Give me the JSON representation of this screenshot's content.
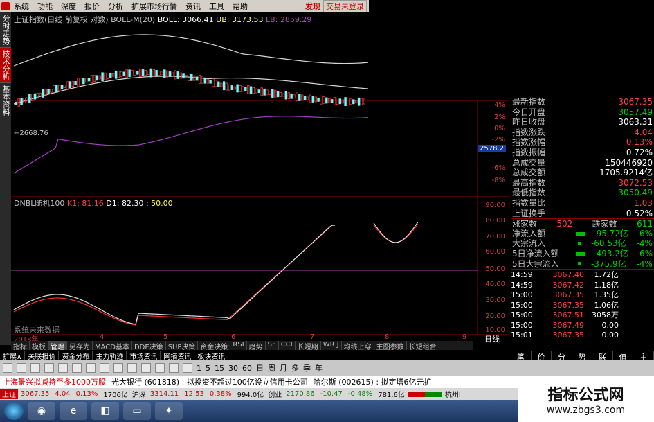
{
  "menu": [
    "系统",
    "功能",
    "深度",
    "报价",
    "分析",
    "扩展市场行情",
    "资讯",
    "工具",
    "帮助"
  ],
  "top_right": {
    "discover": "发现",
    "trade": "交易未登录"
  },
  "left_tabs": [
    "分时走势",
    "技术分析",
    "基本资料"
  ],
  "legend": {
    "title": "上证指数(日线 前复权 对数)",
    "boll": "BOLL-M(20)",
    "boll_val": "BOLL: 3066.41",
    "ub": "UB: 3173.53",
    "lb": "LB: 2859.29",
    "low_label": "←2668.76"
  },
  "indicator": {
    "name": "DNBL随机100",
    "k1": "K1: 81.16",
    "d1": "D1: 82.30",
    "v": ": 50.00",
    "watermark": "系统未来数据"
  },
  "axis_pct": [
    "4%",
    "2%",
    "0%",
    "-2%",
    "-4%",
    "-6%",
    "-8%"
  ],
  "axis_ind": [
    "90.00",
    "80.00",
    "70.00",
    "60.00",
    "50.00",
    "40.00",
    "30.00",
    "20.00",
    "10.00"
  ],
  "blue_tag": "2578.2",
  "x_labels": [
    "2018年",
    "4",
    "5",
    "6",
    "7",
    "8",
    "9"
  ],
  "day_label": "日线",
  "stats": [
    {
      "l": "最新指数",
      "v": "3067.35",
      "c": "red"
    },
    {
      "l": "今日开盘",
      "v": "3057.49",
      "c": "green"
    },
    {
      "l": "昨日收盘",
      "v": "3063.31",
      "c": "white"
    },
    {
      "l": "指数涨跌",
      "v": "4.04",
      "c": "red"
    },
    {
      "l": "指数涨幅",
      "v": "0.13%",
      "c": "red"
    },
    {
      "l": "指数振幅",
      "v": "0.72%",
      "c": "white"
    },
    {
      "l": "总成交量",
      "v": "150446920",
      "c": "white"
    },
    {
      "l": "总成交额",
      "v": "1705.9214亿",
      "c": "white"
    },
    {
      "l": "最高指数",
      "v": "3072.53",
      "c": "red"
    },
    {
      "l": "最低指数",
      "v": "3050.49",
      "c": "green"
    },
    {
      "l": "指数量比",
      "v": "1.03",
      "c": "red"
    },
    {
      "l": "上证换手",
      "v": "0.52%",
      "c": "white"
    }
  ],
  "updown": {
    "up_label": "涨家数",
    "up": "502",
    "down_label": "跌家数",
    "down": "611"
  },
  "flows": [
    {
      "l": "净流入额",
      "v": "-95.72亿",
      "p": "-6%"
    },
    {
      "l": "大宗流入",
      "v": "-60.53亿",
      "p": "-4%"
    },
    {
      "l": "5日净流入额",
      "v": "-493.2亿",
      "p": "-6%"
    },
    {
      "l": "5日大宗流入",
      "v": "-375.9亿",
      "p": "-4%"
    }
  ],
  "ticks": [
    {
      "t": "14:59",
      "p": "3067.40",
      "v": "1.72亿",
      "c": "red"
    },
    {
      "t": "14:59",
      "p": "3067.42",
      "v": "1.18亿",
      "c": "red"
    },
    {
      "t": "15:00",
      "p": "3067.35",
      "v": "1.35亿",
      "c": "red"
    },
    {
      "t": "15:00",
      "p": "3067.35",
      "v": "1.06亿",
      "c": "red"
    },
    {
      "t": "15:00",
      "p": "3067.51",
      "v": "3058万",
      "c": "red"
    },
    {
      "t": "15:00",
      "p": "3067.49",
      "v": "0.00",
      "c": "red"
    },
    {
      "t": "15:01",
      "p": "3067.35",
      "v": "0.00",
      "c": "red"
    }
  ],
  "bottom_tabs": [
    "指标",
    "模板",
    "管理",
    "另存为",
    "MACD基本",
    "DDE决策",
    "SUP决策",
    "资金决策",
    "RSI",
    "趋势",
    "SF",
    "CCI",
    "长短期",
    "WR J",
    "均线上穿",
    "主图参数",
    "长短组合"
  ],
  "row2_tabs": [
    "扩展∧",
    "关联报价",
    "资金分布",
    "主力轨迹",
    "市场资讯",
    "网摘资讯",
    "板块资讯"
  ],
  "side_tabs": [
    "笔",
    "价",
    "分",
    "势",
    "联",
    "值",
    "主"
  ],
  "toolbar_labels": [
    "1",
    "5",
    "15",
    "30",
    "60",
    "日",
    "周",
    "月",
    "多",
    "季",
    "年"
  ],
  "news": [
    "上海景兴拟减持至多1000万股",
    "光大银行 (601818) : 拟投资不超过100亿设立信用卡公司",
    "哈尔斯 (002615) : 拟定增6亿元扩"
  ],
  "status": {
    "sh": "上证",
    "sh_v": "3067.35",
    "sh_c": "4.04",
    "sh_p": "0.13%",
    "sh_vol": "1706亿",
    "sz": "沪深",
    "sz_v": "3314.11",
    "sz_c": "12.53",
    "sz_p": "0.38%",
    "sz_vol": "994.0亿",
    "cy": "创业",
    "cy_v": "2170.86",
    "cy_c": "-10.47",
    "cy_p": "-0.48%",
    "cy_vol": "781.6亿",
    "city": "杭州I"
  },
  "watermark": {
    "title": "指标公式网",
    "url": "www.zbgs3.com"
  }
}
